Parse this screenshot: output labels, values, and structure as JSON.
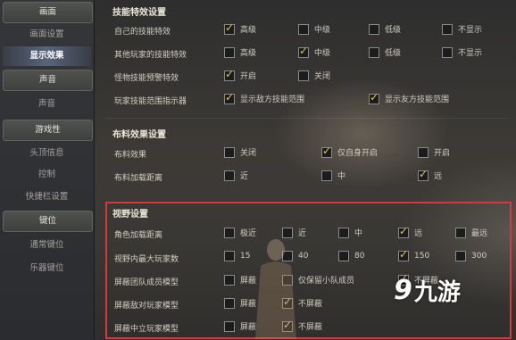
{
  "sidebar": {
    "items": [
      {
        "label": "画面",
        "kind": "cat"
      },
      {
        "label": "画面设置",
        "kind": "sub"
      },
      {
        "label": "显示效果",
        "kind": "sel"
      },
      {
        "label": "声音",
        "kind": "cat"
      },
      {
        "label": "声音",
        "kind": "sub"
      },
      {
        "label": "游戏性",
        "kind": "cat"
      },
      {
        "label": "头顶信息",
        "kind": "sub"
      },
      {
        "label": "控制",
        "kind": "sub"
      },
      {
        "label": "快捷栏设置",
        "kind": "sub"
      },
      {
        "label": "键位",
        "kind": "cat"
      },
      {
        "label": "通常键位",
        "kind": "sub"
      },
      {
        "label": "乐器键位",
        "kind": "sub"
      }
    ]
  },
  "sections": {
    "skill": {
      "title": "技能特效设置",
      "rows": [
        {
          "label": "自己的技能特效",
          "options": [
            {
              "label": "高级",
              "checked": true
            },
            {
              "label": "中级",
              "checked": false
            },
            {
              "label": "低级",
              "checked": false
            },
            {
              "label": "不显示",
              "checked": false
            }
          ]
        },
        {
          "label": "其他玩家的技能特效",
          "options": [
            {
              "label": "高级",
              "checked": false
            },
            {
              "label": "中级",
              "checked": true
            },
            {
              "label": "低级",
              "checked": false
            },
            {
              "label": "不显示",
              "checked": false
            }
          ]
        },
        {
          "label": "怪物技能预警特效",
          "options": [
            {
              "label": "开启",
              "checked": true
            },
            {
              "label": "关闭",
              "checked": false
            }
          ]
        },
        {
          "label": "玩家技能范围指示器",
          "options": [
            {
              "label": "显示敌方技能范围",
              "checked": true
            },
            {
              "label": "显示友方技能范围",
              "checked": true
            }
          ]
        }
      ]
    },
    "cloth": {
      "title": "布料效果设置",
      "rows": [
        {
          "label": "布料效果",
          "options": [
            {
              "label": "关闭",
              "checked": false
            },
            {
              "label": "仅自身开启",
              "checked": true
            },
            {
              "label": "开启",
              "checked": false
            }
          ]
        },
        {
          "label": "布料加载距离",
          "options": [
            {
              "label": "近",
              "checked": false
            },
            {
              "label": "中",
              "checked": false
            },
            {
              "label": "远",
              "checked": true
            }
          ]
        }
      ]
    },
    "view": {
      "title": "视野设置",
      "rows": [
        {
          "label": "角色加载距离",
          "options": [
            {
              "label": "极近",
              "checked": false
            },
            {
              "label": "近",
              "checked": false
            },
            {
              "label": "中",
              "checked": false
            },
            {
              "label": "远",
              "checked": true
            },
            {
              "label": "最远",
              "checked": false
            }
          ]
        },
        {
          "label": "视野内最大玩家数",
          "options": [
            {
              "label": "15",
              "checked": false
            },
            {
              "label": "40",
              "checked": false
            },
            {
              "label": "80",
              "checked": false
            },
            {
              "label": "150",
              "checked": true
            },
            {
              "label": "300",
              "checked": false
            }
          ]
        },
        {
          "label": "屏蔽团队成员模型",
          "options": [
            {
              "label": "屏蔽",
              "checked": false
            },
            {
              "label": "仅保留小队成员",
              "checked": false
            },
            {
              "label": "不屏蔽",
              "checked": true
            }
          ]
        },
        {
          "label": "屏蔽敌对玩家模型",
          "options": [
            {
              "label": "屏蔽",
              "checked": false
            },
            {
              "label": "不屏蔽",
              "checked": true
            }
          ]
        },
        {
          "label": "屏蔽中立玩家模型",
          "options": [
            {
              "label": "屏蔽",
              "checked": false
            },
            {
              "label": "不屏蔽",
              "checked": true
            }
          ]
        }
      ]
    }
  },
  "watermark": {
    "mark": "9",
    "text": "九游"
  },
  "colors": {
    "accent": "#e8c24a",
    "highlight_border": "#d8383a",
    "panel_bg": "#24262a"
  }
}
